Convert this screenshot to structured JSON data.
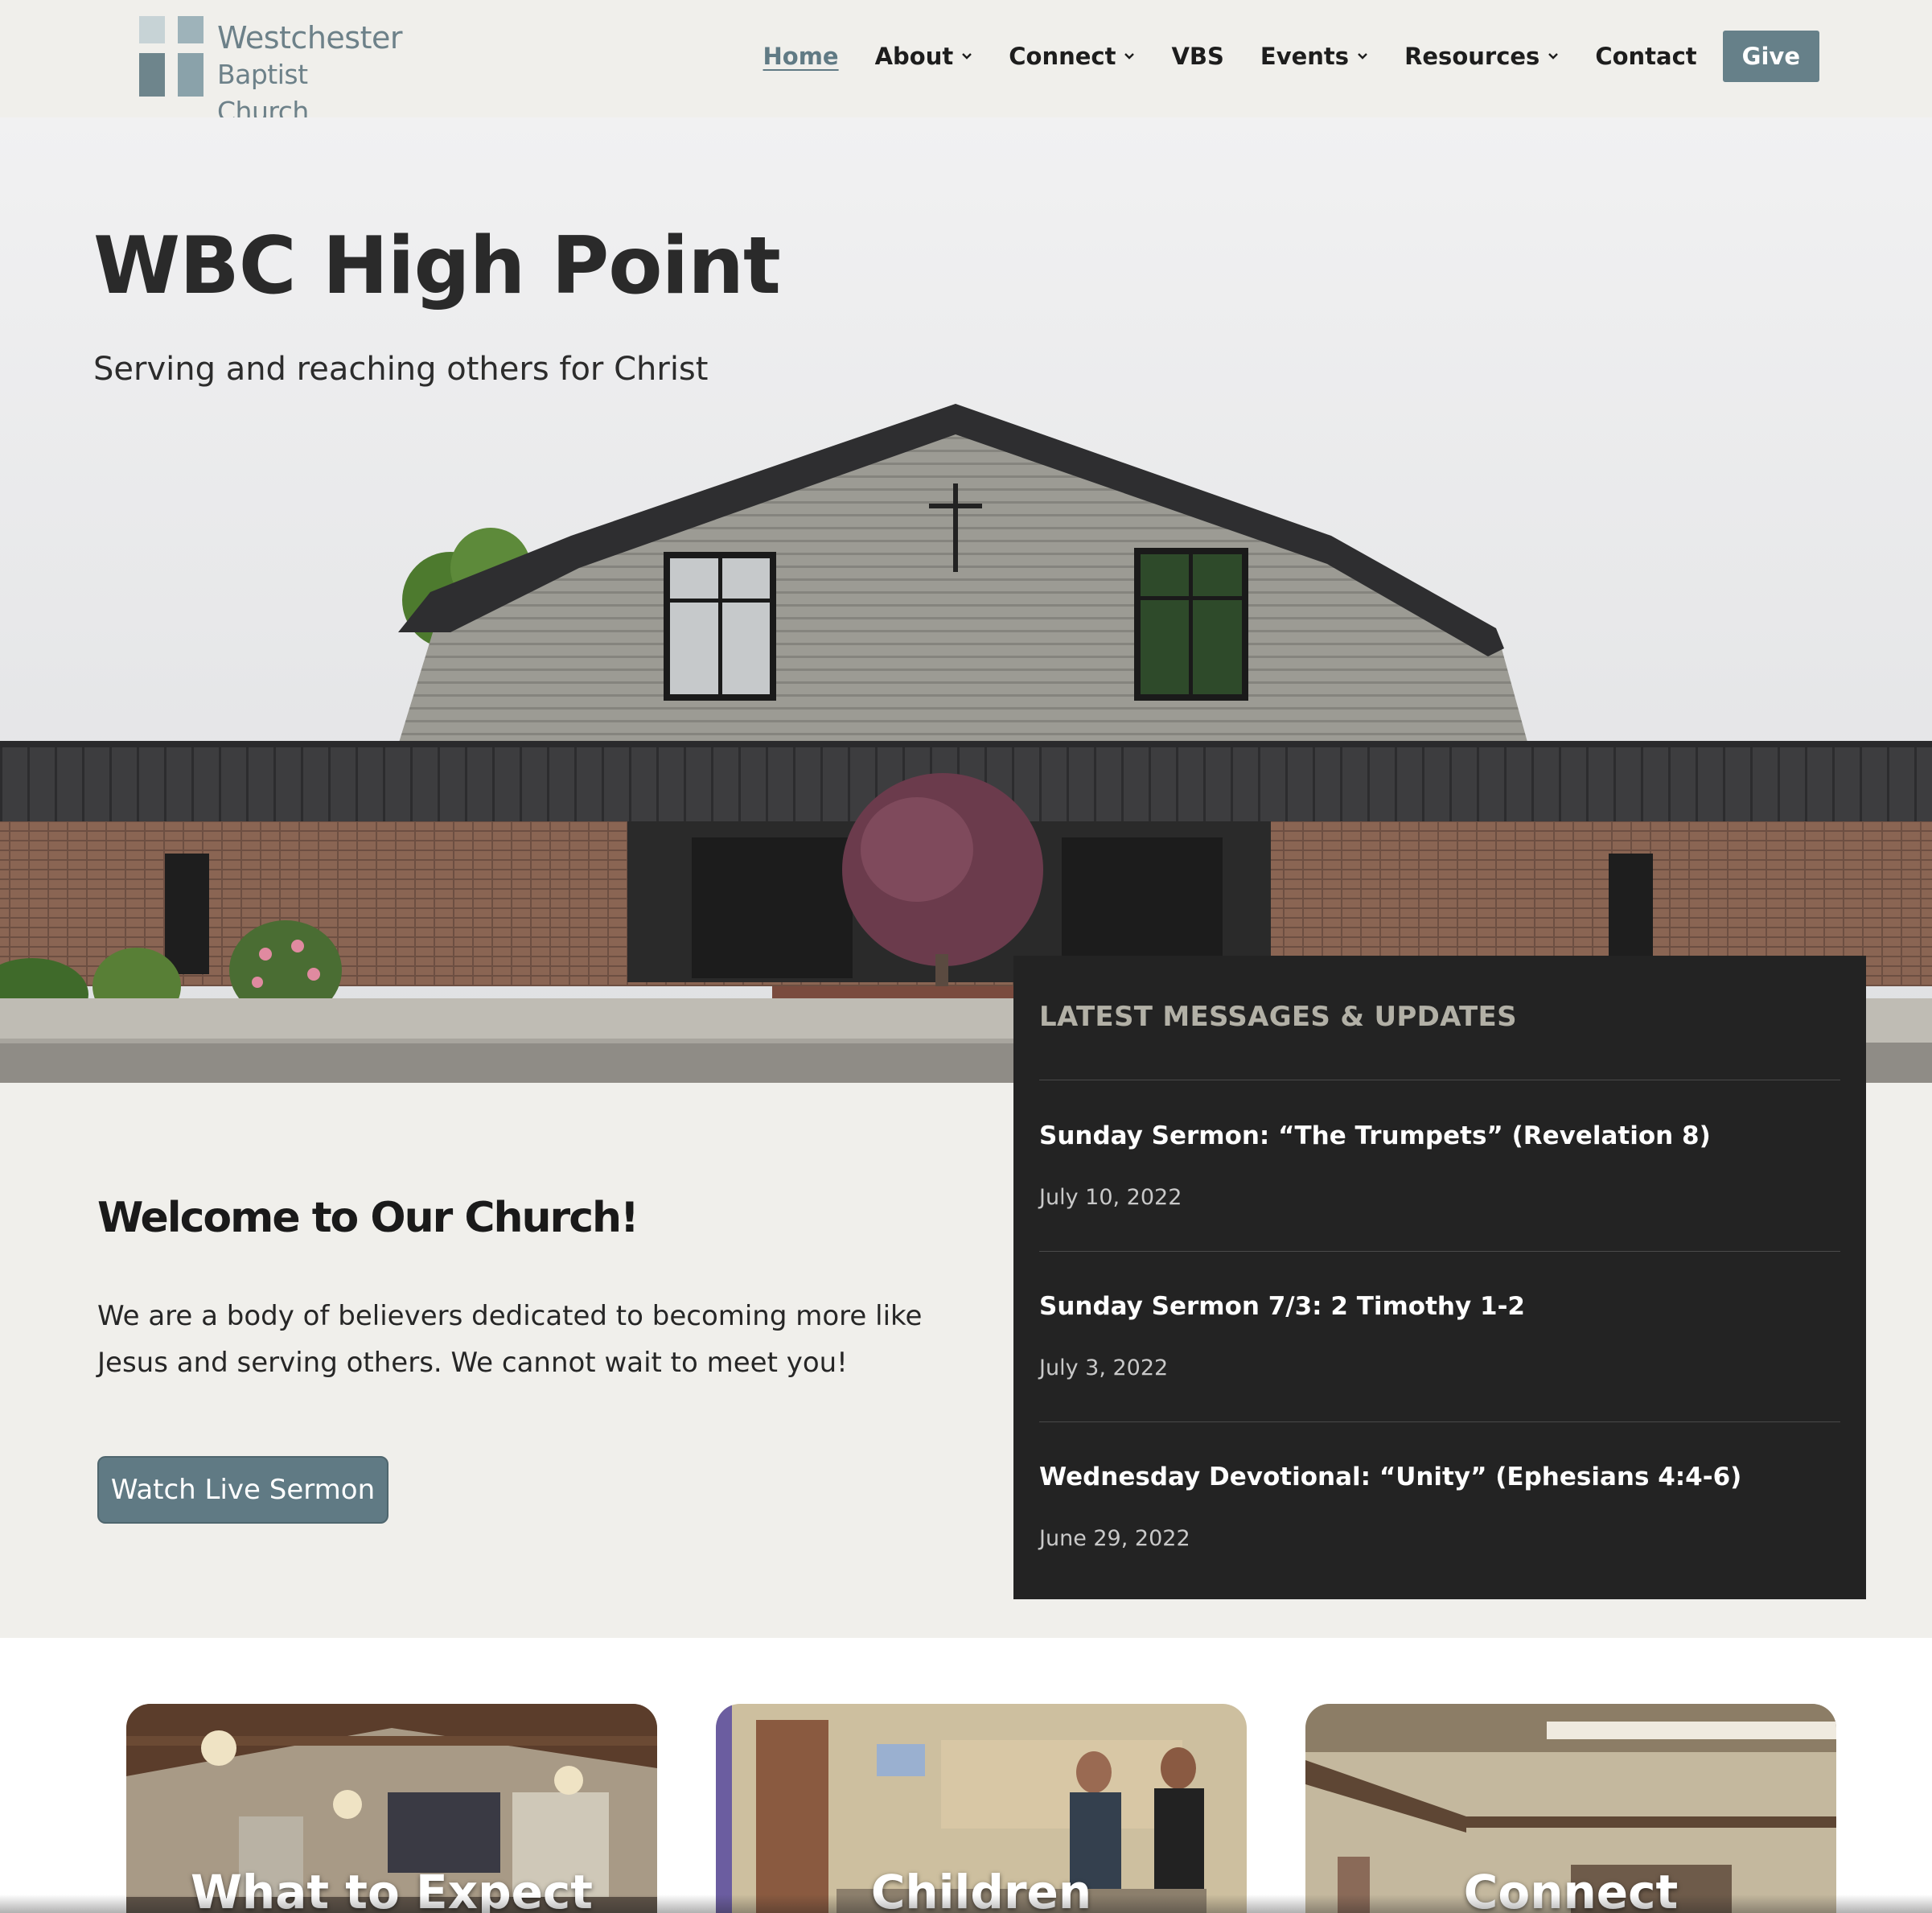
{
  "brand": {
    "name_line1": "Westchester",
    "name_line2": "Baptist Church",
    "colors": {
      "accent": "#668089",
      "panel": "#232323",
      "background": "#f0efeb"
    }
  },
  "nav": {
    "items": [
      {
        "label": "Home",
        "active": true,
        "has_dropdown": false
      },
      {
        "label": "About",
        "has_dropdown": true
      },
      {
        "label": "Connect",
        "has_dropdown": true
      },
      {
        "label": "VBS",
        "has_dropdown": false
      },
      {
        "label": "Events",
        "has_dropdown": true
      },
      {
        "label": "Resources",
        "has_dropdown": true
      },
      {
        "label": "Contact",
        "has_dropdown": false
      }
    ],
    "give_label": "Give"
  },
  "hero": {
    "title": "WBC High Point",
    "subtitle": "Serving and reaching others for Christ"
  },
  "welcome": {
    "title": "Welcome to Our Church!",
    "text": "We are a body of believers dedicated to becoming more like Jesus and serving others. We cannot wait to meet you!",
    "button_label": "Watch Live Sermon"
  },
  "messages": {
    "title": "LATEST MESSAGES & UPDATES",
    "items": [
      {
        "title": "Sunday Sermon: “The Trumpets” (Revelation 8)",
        "date": "July 10, 2022"
      },
      {
        "title": "Sunday Sermon 7/3: 2 Timothy 1-2",
        "date": "July 3, 2022"
      },
      {
        "title": "Wednesday Devotional: “Unity” (Ephesians 4:4-6)",
        "date": "June 29, 2022"
      }
    ]
  },
  "cards": [
    {
      "label": "What to Expect"
    },
    {
      "label": "Children"
    },
    {
      "label": "Connect"
    }
  ]
}
